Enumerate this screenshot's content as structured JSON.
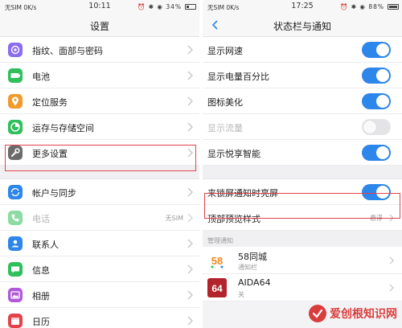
{
  "left": {
    "status": {
      "carrier": "无SIM 0K/s",
      "time": "10:11",
      "icons": "⏰ ✱ ◉",
      "battery": "34%"
    },
    "title": "设置",
    "group1": [
      {
        "label": "指纹、面部与密码",
        "icon": "fingerprint-icon",
        "color": "#8b6cf0"
      },
      {
        "label": "电池",
        "icon": "battery-icon",
        "color": "#2fbf5b"
      },
      {
        "label": "定位服务",
        "icon": "location-icon",
        "color": "#f39a2c"
      },
      {
        "label": "运存与存储空间",
        "icon": "storage-icon",
        "color": "#2fbf5b"
      },
      {
        "label": "更多设置",
        "icon": "wrench-icon",
        "color": "#6b6b6b"
      }
    ],
    "group2": [
      {
        "label": "帐户与同步",
        "icon": "account-sync-icon",
        "color": "#2d86ea",
        "value": ""
      },
      {
        "label": "电话",
        "icon": "phone-icon",
        "color": "#2fbf5b",
        "value": "无SIM"
      },
      {
        "label": "联系人",
        "icon": "contacts-icon",
        "color": "#2d86ea",
        "value": ""
      },
      {
        "label": "信息",
        "icon": "message-icon",
        "color": "#2fbf5b",
        "value": ""
      },
      {
        "label": "相册",
        "icon": "album-icon",
        "color": "#b15ad8",
        "value": ""
      },
      {
        "label": "日历",
        "icon": "calendar-icon",
        "color": "#e2434b",
        "value": ""
      }
    ]
  },
  "right": {
    "status": {
      "carrier": "无SIM 0K/s",
      "time": "17:25",
      "icons": "⏰ ✱ ◉",
      "battery": "88%"
    },
    "title": "状态栏与通知",
    "toggles1": [
      {
        "label": "显示网速",
        "on": true,
        "enabled": true
      },
      {
        "label": "显示电量百分比",
        "on": true,
        "enabled": true
      },
      {
        "label": "图标美化",
        "on": true,
        "enabled": true
      },
      {
        "label": "显示流量",
        "on": false,
        "enabled": false
      },
      {
        "label": "显示悦享智能",
        "on": true,
        "enabled": true
      }
    ],
    "lockscreen": {
      "label": "来锁屏通知时亮屏",
      "on": true
    },
    "top_preview": {
      "label": "顶部预览样式",
      "value": "悬浮"
    },
    "section_label": "管理通知",
    "apps": [
      {
        "name": "58同城",
        "sub": "通知栏",
        "icon": "app-58-icon"
      },
      {
        "name": "AIDA64",
        "sub": "关",
        "icon": "app-aida64-icon"
      }
    ]
  },
  "watermark": {
    "text": "爱创根知识网"
  }
}
